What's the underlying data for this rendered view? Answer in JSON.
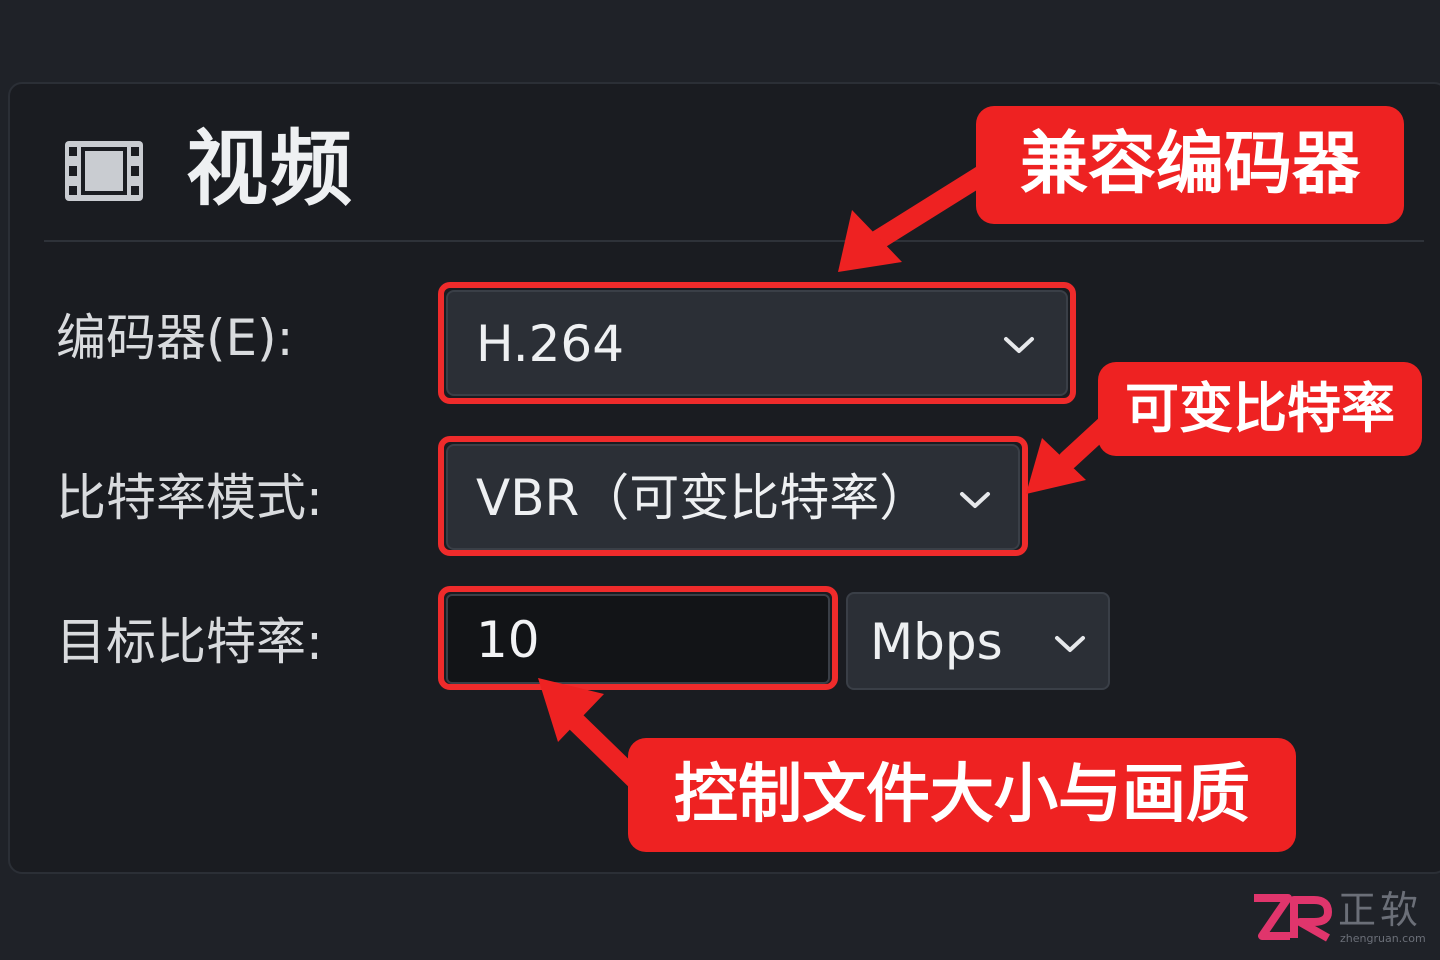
{
  "section": {
    "title": "视频",
    "icon": "film-icon"
  },
  "form": {
    "encoder": {
      "label": "编码器(E):",
      "value": "H.264"
    },
    "bitrate_mode": {
      "label": "比特率模式:",
      "value": "VBR（可变比特率）"
    },
    "target_bitrate": {
      "label": "目标比特率:",
      "value": "10",
      "unit": "Mbps"
    }
  },
  "annotations": {
    "encoder_callout": "兼容编码器",
    "bitrate_mode_callout": "可变比特率",
    "bitrate_callout": "控制文件大小与画质"
  },
  "watermark": {
    "logo": "ZR",
    "name": "正软",
    "domain": "zhengruan.com"
  },
  "colors": {
    "background": "#1f2228",
    "panel": "#1a1c21",
    "highlight": "#ef2b2b",
    "callout": "#ee2222"
  }
}
